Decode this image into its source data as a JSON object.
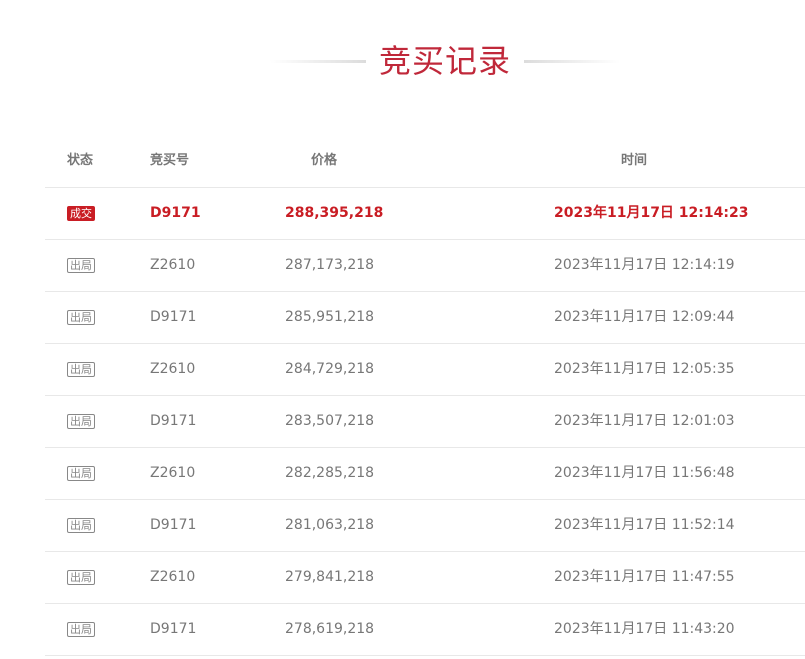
{
  "page": {
    "title": "竞买记录"
  },
  "table": {
    "headers": {
      "status": "状态",
      "bidder": "竞买号",
      "price": "价格",
      "time": "时间"
    },
    "rows": [
      {
        "status": "成交",
        "status_type": "win",
        "bidder": "D9171",
        "price": "288,395,218",
        "time": "2023年11月17日 12:14:23"
      },
      {
        "status": "出局",
        "status_type": "out",
        "bidder": "Z2610",
        "price": "287,173,218",
        "time": "2023年11月17日 12:14:19"
      },
      {
        "status": "出局",
        "status_type": "out",
        "bidder": "D9171",
        "price": "285,951,218",
        "time": "2023年11月17日 12:09:44"
      },
      {
        "status": "出局",
        "status_type": "out",
        "bidder": "Z2610",
        "price": "284,729,218",
        "time": "2023年11月17日 12:05:35"
      },
      {
        "status": "出局",
        "status_type": "out",
        "bidder": "D9171",
        "price": "283,507,218",
        "time": "2023年11月17日 12:01:03"
      },
      {
        "status": "出局",
        "status_type": "out",
        "bidder": "Z2610",
        "price": "282,285,218",
        "time": "2023年11月17日 11:56:48"
      },
      {
        "status": "出局",
        "status_type": "out",
        "bidder": "D9171",
        "price": "281,063,218",
        "time": "2023年11月17日 11:52:14"
      },
      {
        "status": "出局",
        "status_type": "out",
        "bidder": "Z2610",
        "price": "279,841,218",
        "time": "2023年11月17日 11:47:55"
      },
      {
        "status": "出局",
        "status_type": "out",
        "bidder": "D9171",
        "price": "278,619,218",
        "time": "2023年11月17日 11:43:20"
      }
    ]
  },
  "colors": {
    "accent": "#c0283a",
    "win": "#c91d24",
    "text_muted": "#777777",
    "divider": "#e8e8e8"
  }
}
